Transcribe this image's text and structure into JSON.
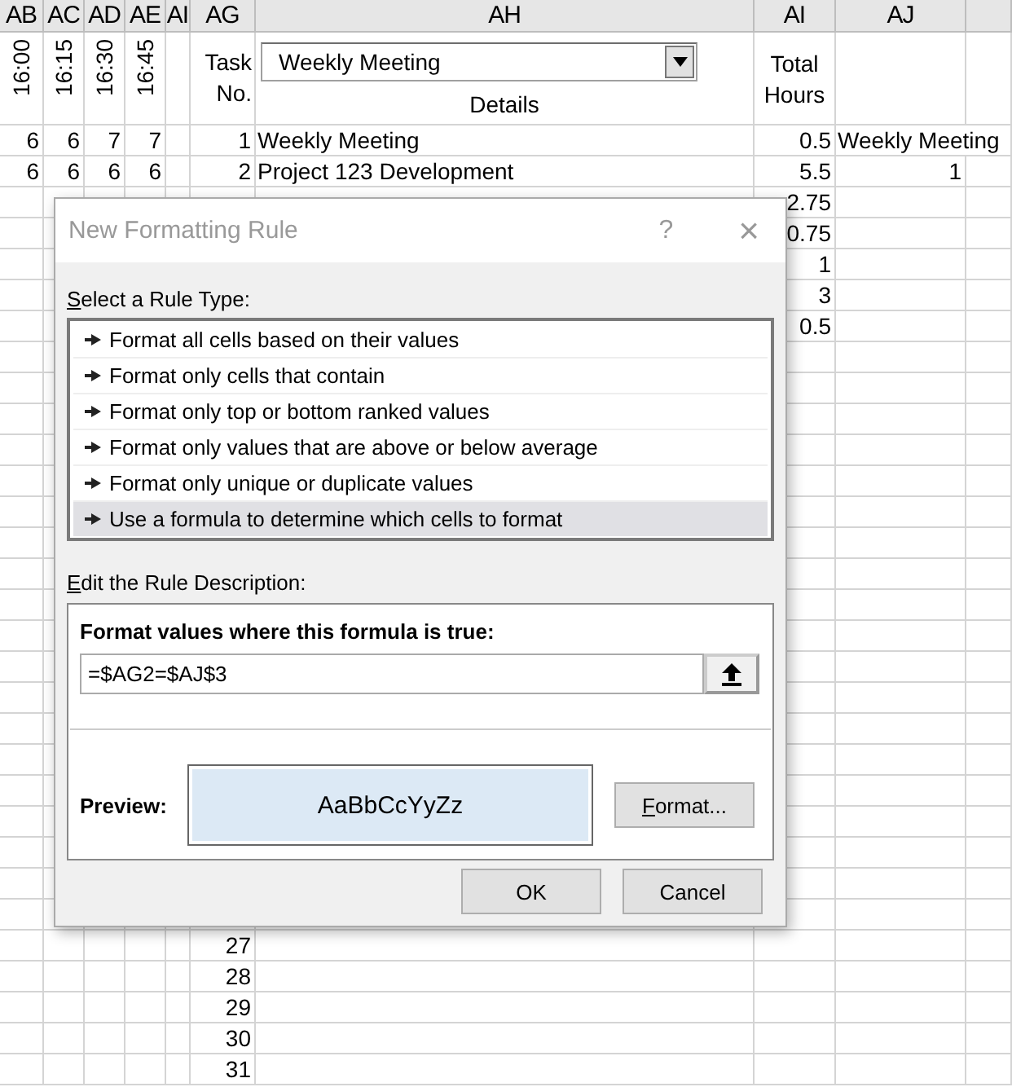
{
  "column_headers": [
    "AB",
    "AC",
    "AD",
    "AE",
    "AI",
    "AG",
    "AH",
    "AI",
    "AJ"
  ],
  "time_headers": [
    "16:00",
    "16:15",
    "16:30",
    "16:45"
  ],
  "header": {
    "task_no": "Task No.",
    "details": "Details",
    "total_hours": "Total Hours"
  },
  "task_filter": {
    "value": "Weekly Meeting"
  },
  "rows_top": [
    {
      "times": [
        "6",
        "6",
        "7",
        "7"
      ],
      "task_no": "1",
      "details": "Weekly Meeting",
      "total_hours": "0.5",
      "column_aj": "Weekly Meeting"
    },
    {
      "times": [
        "6",
        "6",
        "6",
        "6"
      ],
      "task_no": "2",
      "details": "Project 123 Development",
      "total_hours": "5.5",
      "column_aj": "1"
    },
    {
      "total_hours": "2.75"
    },
    {
      "total_hours": "0.75"
    },
    {
      "total_hours": "1"
    },
    {
      "total_hours": "3"
    },
    {
      "total_hours": "0.5"
    }
  ],
  "rows_bottom": [
    {
      "task_no": "27"
    },
    {
      "task_no": "28"
    },
    {
      "task_no": "29"
    },
    {
      "task_no": "30"
    },
    {
      "task_no": "31"
    }
  ],
  "dialog": {
    "title": "New Formatting Rule",
    "help": "?",
    "close": "×",
    "rule_type_label": "Select a Rule Type:",
    "rule_types": [
      {
        "label": "Format all cells based on their values",
        "selected": false
      },
      {
        "label": "Format only cells that contain",
        "selected": false
      },
      {
        "label": "Format only top or bottom ranked values",
        "selected": false
      },
      {
        "label": "Format only values that are above or below average",
        "selected": false
      },
      {
        "label": "Format only unique or duplicate values",
        "selected": false
      },
      {
        "label": "Use a formula to determine which cells to format",
        "selected": true
      }
    ],
    "description_label": "Edit the Rule Description:",
    "formula_label": "Format values where this formula is true:",
    "formula": "=$AG2=$AJ$3",
    "preview_label": "Preview:",
    "preview_text": "AaBbCcYyZz",
    "format_button": "Format...",
    "buttons": [
      "OK",
      "Cancel"
    ]
  }
}
